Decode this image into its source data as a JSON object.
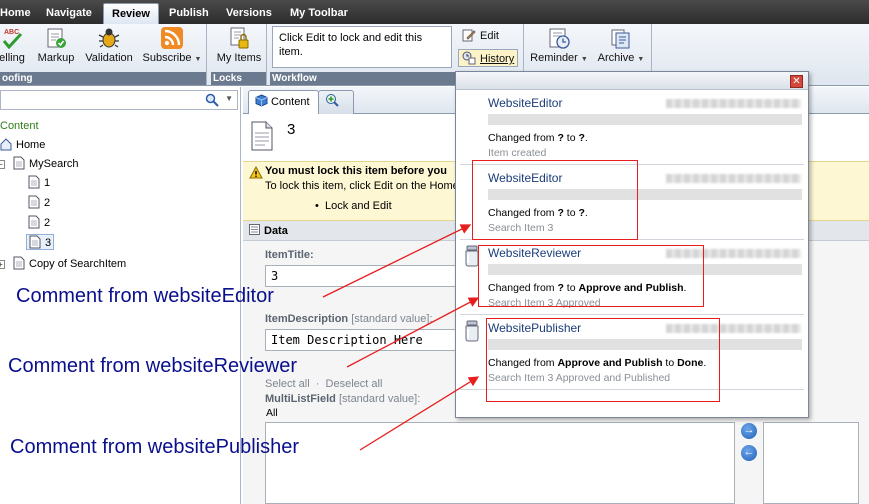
{
  "menu": {
    "tabs": [
      {
        "label": "Home"
      },
      {
        "label": "Navigate"
      },
      {
        "label": "Review",
        "active": true
      },
      {
        "label": "Publish"
      },
      {
        "label": "Versions"
      },
      {
        "label": "My Toolbar"
      }
    ]
  },
  "ribbon": {
    "proofing": {
      "group_label": "oofing",
      "spelling_label": "elling",
      "spelling_badge": "ABC",
      "markup_label": "Markup",
      "validation_label": "Validation",
      "subscribe_label": "Subscribe"
    },
    "locks": {
      "group_label": "Locks",
      "my_items_label": "My Items"
    },
    "workflow": {
      "group_label": "Workflow",
      "message": "Click Edit to lock and edit this item.",
      "edit_label": "Edit",
      "history_label": "History"
    },
    "other": {
      "reminder_label": "Reminder",
      "archive_label": "Archive"
    }
  },
  "tree": {
    "items": [
      {
        "label": "Content",
        "color": "#2f7d1a"
      },
      {
        "label": "Home"
      },
      {
        "label": "MySearch"
      },
      {
        "label": "1"
      },
      {
        "label": "2"
      },
      {
        "label": "2"
      },
      {
        "label": "3"
      },
      {
        "label": "Copy of SearchItem"
      }
    ]
  },
  "content": {
    "tab_label": "Content",
    "item_title": "3",
    "warning": {
      "title": "You must lock this item before you",
      "text": "To lock this item, click Edit on the Home",
      "bullet": "Lock and Edit"
    },
    "section_label": "Data",
    "fields": {
      "item_title_label": "ItemTitle:",
      "item_title_value": "3",
      "item_description_label": "ItemDescription",
      "item_description_std": "[standard value]:",
      "item_description_value": "Item Description Here",
      "select_all": "Select all",
      "deselect_all": "Deselect all",
      "multilist_label": "MultiListField",
      "multilist_std": "[standard value]:",
      "multilist_all": "All"
    }
  },
  "history": {
    "entries": [
      {
        "user": "WebsiteEditor",
        "change_prefix": "Changed from ",
        "from": "?",
        "mid": " to ",
        "to": "?",
        "suffix": ".",
        "sub": "Item created"
      },
      {
        "user": "WebsiteEditor",
        "change_prefix": "Changed from ",
        "from": "?",
        "mid": " to ",
        "to": "?",
        "suffix": ".",
        "sub": "Search Item 3"
      },
      {
        "user": "WebsiteReviewer",
        "change_prefix": "Changed from ",
        "from": "?",
        "mid": " to ",
        "to": "Approve and Publish",
        "suffix": ".",
        "sub": "Search Item 3 Approved"
      },
      {
        "user": "WebsitePublisher",
        "change_prefix": "Changed from ",
        "from": "Approve and Publish",
        "mid": " to ",
        "to": "Done",
        "suffix": ".",
        "sub": "Search Item 3 Approved and Published"
      }
    ]
  },
  "annotations": {
    "editor": "Comment from websiteEditor",
    "reviewer": "Comment from websiteReviewer",
    "publisher": "Comment from websitePublisher"
  },
  "colors": {
    "annotation_text": "#0a0f8c",
    "annotation_arrow": "#e81e1e",
    "history_user": "#1c3d7a"
  },
  "icons": {
    "spelling": "spellcheck-icon",
    "markup": "markup-icon",
    "validation": "validation-bug-icon",
    "subscribe": "rss-icon",
    "my_items": "lock-items-icon",
    "edit": "edit-pencil-icon",
    "history": "history-icon",
    "reminder": "reminder-clock-icon",
    "archive": "archive-icon",
    "close": "close-icon"
  }
}
